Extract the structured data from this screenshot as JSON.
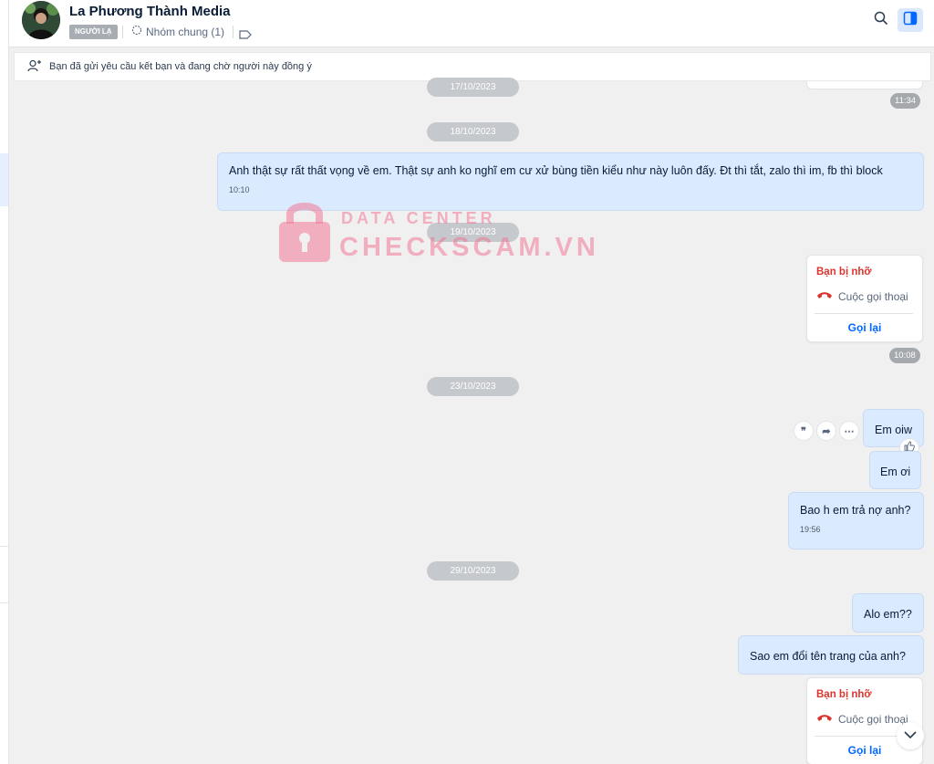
{
  "header": {
    "name": "La Phương Thành Media",
    "badge": "NGƯỜI LẠ",
    "group": "Nhóm chung (1)"
  },
  "icons": {
    "search": "search-icon",
    "panel": "panel-toggle-icon",
    "group": "group-icon",
    "tag": "tag-icon",
    "add_friend": "add-friend-icon",
    "missed_call": "missed-call-icon",
    "scroll_down": "chevron-down-icon",
    "like": "thumbs-up-icon"
  },
  "colors": {
    "accent": "#0068ff",
    "missed": "#db342e",
    "bubble": "#dbebff"
  },
  "friend_request": "Bạn đã gửi yêu cầu kết bạn và đang chờ người này đồng ý",
  "dates": {
    "d1": "17/10/2023",
    "d2": "18/10/2023",
    "d3": "19/10/2023",
    "d4": "23/10/2023",
    "d5": "29/10/2023"
  },
  "messages": {
    "top_time": "11:34",
    "m1": {
      "text": "Anh thật sự rất thất vọng về em. Thật sự anh ko nghĩ em cư xử bùng tiền kiểu như này luôn đấy. Đt thì tắt, zalo thì im, fb thì block",
      "time": "10:10"
    },
    "call1": {
      "title": "Bạn bị nhỡ",
      "label": "Cuộc gọi thoại",
      "action": "Gọi lại",
      "time": "10:08"
    },
    "m2": {
      "text": "Em oiw"
    },
    "m3": {
      "text": "Em ơi"
    },
    "m4": {
      "text": "Bao h em trả nợ anh?",
      "time": "19:56"
    },
    "m5": {
      "text": "Alo em??"
    },
    "m6": {
      "text": "Sao em đổi tên trang của anh?"
    },
    "call2": {
      "title": "Bạn bị nhỡ",
      "label": "Cuộc gọi thoại",
      "action": "Gọi lại"
    }
  },
  "message_actions": {
    "quote": "❞",
    "forward": "➦",
    "more": "⋯"
  },
  "watermark": {
    "sub": "DATA CENTER",
    "main": "CHECKSCAM.VN"
  }
}
